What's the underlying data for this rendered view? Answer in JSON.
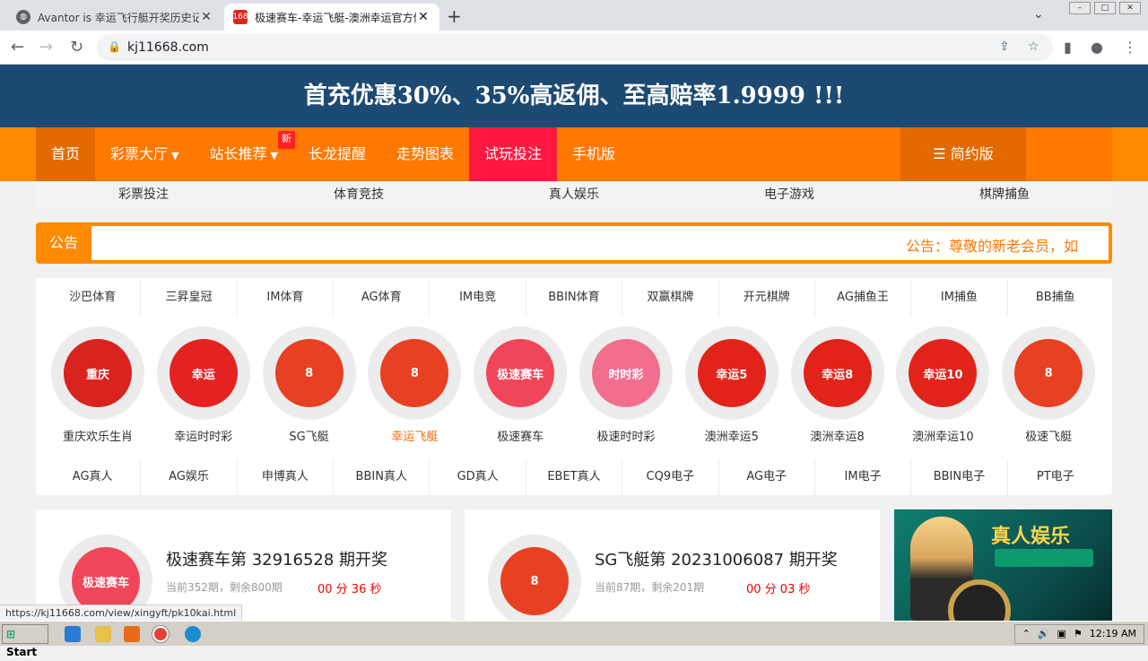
{
  "browser": {
    "tabs": [
      {
        "title": "Avantor is 幸运飞行艇开奖历史记录",
        "active": false
      },
      {
        "title": "极速赛车-幸运飞艇-澳洲幸运官方体",
        "active": true
      }
    ],
    "url": "kj11668.com",
    "status_url": "https://kj11668.com/view/xingyft/pk10kai.html"
  },
  "banner": {
    "text": "首充优惠30%、35%高返佣、至高赔率1.9999 !!!"
  },
  "nav": {
    "items": [
      {
        "label": "首页",
        "style": "active"
      },
      {
        "label": "彩票大厅",
        "caret": true
      },
      {
        "label": "站长推荐",
        "caret": true,
        "badge": "新"
      },
      {
        "label": "长龙提醒"
      },
      {
        "label": "走势图表"
      },
      {
        "label": "试玩投注",
        "style": "red"
      },
      {
        "label": "手机版"
      }
    ],
    "simple_label": "简约版"
  },
  "subnav": [
    "彩票投注",
    "体育竞技",
    "真人娱乐",
    "电子游戏",
    "棋牌捕鱼"
  ],
  "notice": {
    "label": "公告",
    "text": "公告：尊敬的新老会员，如"
  },
  "platforms_row1": [
    "沙巴体育",
    "三昇皇冠",
    "IM体育",
    "AG体育",
    "IM电竞",
    "BBIN体育",
    "双赢棋牌",
    "开元棋牌",
    "AG捕鱼王",
    "IM捕鱼",
    "BB捕鱼"
  ],
  "games": [
    {
      "name": "重庆欢乐生肖",
      "logo": "重庆",
      "color": "#d8231e"
    },
    {
      "name": "幸运时时彩",
      "logo": "幸运",
      "color": "#e52222"
    },
    {
      "name": "SG飞艇",
      "logo": "8",
      "color": "#e74022"
    },
    {
      "name": "幸运飞艇",
      "logo": "8",
      "color": "#e74022",
      "highlight": true
    },
    {
      "name": "极速赛车",
      "logo": "极速赛车",
      "color": "#f1465a"
    },
    {
      "name": "极速时时彩",
      "logo": "时时彩",
      "color": "#f36d8f"
    },
    {
      "name": "澳洲幸运5",
      "logo": "幸运5",
      "color": "#e2231a"
    },
    {
      "name": "澳洲幸运8",
      "logo": "幸运8",
      "color": "#e2231a"
    },
    {
      "name": "澳洲幸运10",
      "logo": "幸运10",
      "color": "#e2231a"
    },
    {
      "name": "极速飞艇",
      "logo": "8",
      "color": "#e74022"
    }
  ],
  "platforms_row2": [
    "AG真人",
    "AG娱乐",
    "申博真人",
    "BBIN真人",
    "GD真人",
    "EBET真人",
    "CQ9电子",
    "AG电子",
    "IM电子",
    "BBIN电子",
    "PT电子"
  ],
  "cards": [
    {
      "title": "极速赛车第 32916528 期开奖",
      "sub": "当前352期，剩余800期",
      "timer": "00 分 36 秒",
      "logo": "极速赛车",
      "color": "#f1465a"
    },
    {
      "title": "SG飞艇第 20231006087 期开奖",
      "sub": "当前87期，剩余201期",
      "timer": "00 分 03 秒",
      "logo": "8",
      "color": "#e74022"
    }
  ],
  "promo": {
    "title": "真人娱乐"
  },
  "taskbar": {
    "start": "Start",
    "time": "12:19 AM"
  }
}
